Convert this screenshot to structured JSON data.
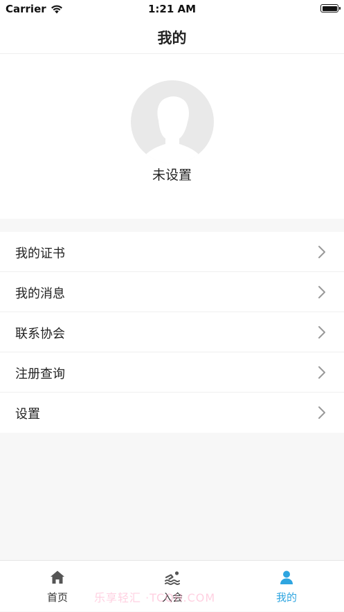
{
  "status_bar": {
    "carrier": "Carrier",
    "time": "1:21 AM"
  },
  "nav": {
    "title": "我的"
  },
  "profile": {
    "name": "未设置"
  },
  "menu": {
    "items": [
      {
        "label": "我的证书"
      },
      {
        "label": "我的消息"
      },
      {
        "label": "联系协会"
      },
      {
        "label": "注册查询"
      },
      {
        "label": "设置"
      }
    ]
  },
  "tabs": {
    "items": [
      {
        "label": "首页",
        "icon": "home-icon"
      },
      {
        "label": "入会",
        "icon": "swimmer-icon"
      },
      {
        "label": "我的",
        "icon": "user-icon"
      }
    ],
    "active_index": 2,
    "active_color": "#2ea5e0",
    "inactive_color": "#555555"
  },
  "watermark": {
    "text": "乐享轻汇 ·TCQH.COM"
  }
}
